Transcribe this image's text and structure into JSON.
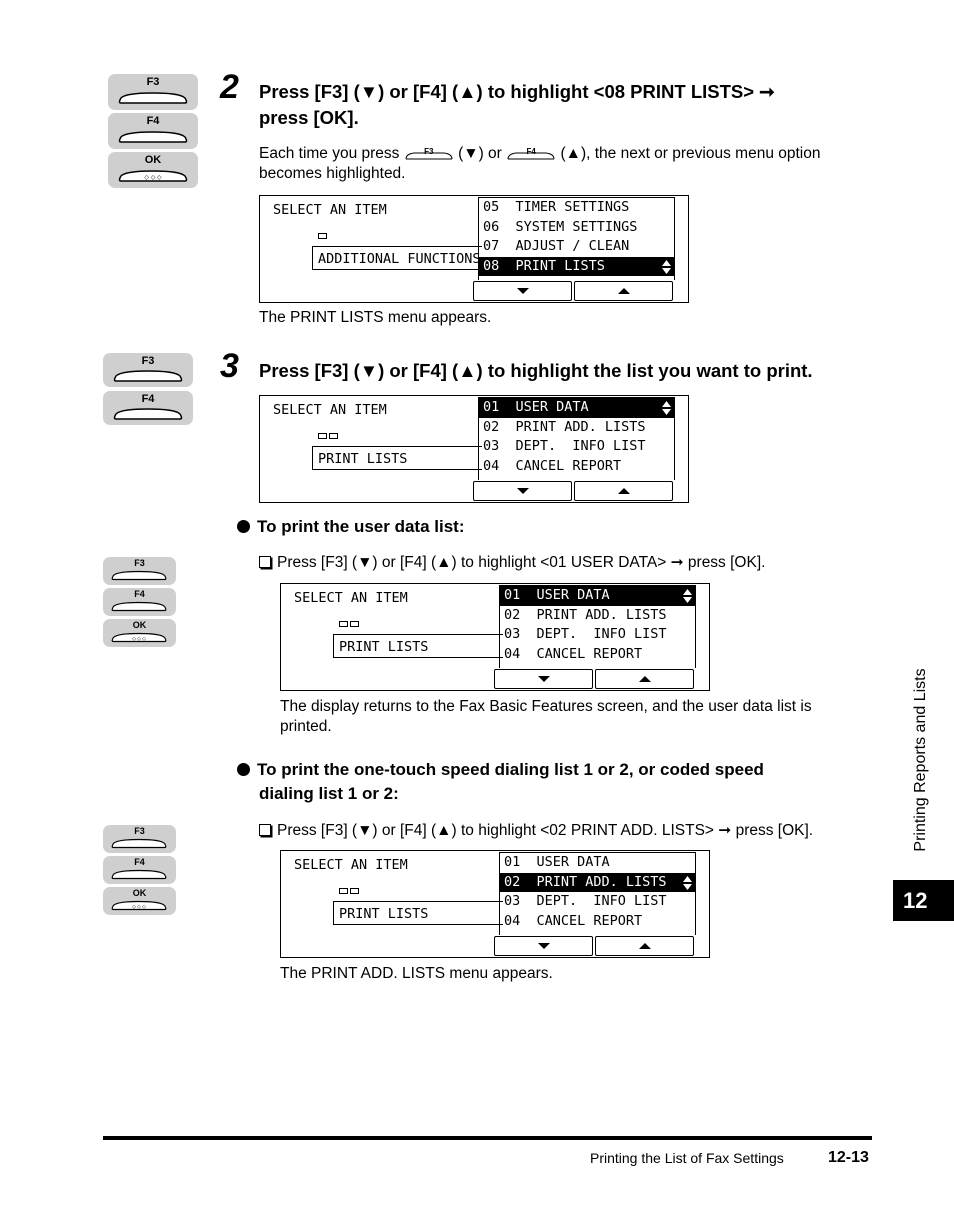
{
  "steps": [
    {
      "number": "2",
      "heading_line1": "Press [F3] (▼) or [F4] (▲) to highlight <08 PRINT LISTS> ➞",
      "heading_line2": "press [OK].",
      "keys": [
        "F3",
        "F4",
        "OK"
      ],
      "body_part1": "Each time you press",
      "body_key1": "F3",
      "body_part2": "(▼) or",
      "body_key2": "F4",
      "body_part3": "(▲), the next or previous menu option",
      "body_line2": "becomes highlighted.",
      "screen": {
        "title": "SELECT AN ITEM",
        "current": "ADDITIONAL FUNCTIONS",
        "menu": [
          "05  TIMER SETTINGS",
          "06  SYSTEM SETTINGS",
          "07  ADJUST / CLEAN",
          "08  PRINT LISTS"
        ],
        "selected_index": 3
      },
      "result": "The PRINT LISTS menu appears."
    },
    {
      "number": "3",
      "heading": "Press [F3] (▼) or [F4] (▲) to highlight the list you want to print.",
      "keys": [
        "F3",
        "F4"
      ],
      "screen": {
        "title": "SELECT AN ITEM",
        "current": "PRINT LISTS",
        "menu": [
          "01  USER DATA",
          "02  PRINT ADD. LISTS",
          "03  DEPT.  INFO LIST",
          "04  CANCEL REPORT"
        ],
        "selected_index": 0
      }
    }
  ],
  "sections": [
    {
      "heading": "To print the user data list:",
      "keys": [
        "F3",
        "F4",
        "OK"
      ],
      "instruction": "Press [F3] (▼) or [F4] (▲) to highlight <01 USER DATA> ➞ press [OK].",
      "screen": {
        "title": "SELECT AN ITEM",
        "current": "PRINT LISTS",
        "menu": [
          "01  USER DATA",
          "02  PRINT ADD. LISTS",
          "03  DEPT.  INFO LIST",
          "04  CANCEL REPORT"
        ],
        "selected_index": 0
      },
      "result_line1": "The display returns to the Fax Basic Features screen, and the user data list is",
      "result_line2": "printed."
    },
    {
      "heading_line1": "To print the one-touch speed dialing list 1 or 2, or coded speed",
      "heading_line2": "dialing list 1 or 2:",
      "keys": [
        "F3",
        "F4",
        "OK"
      ],
      "instruction": "Press [F3] (▼) or [F4] (▲) to highlight <02 PRINT ADD. LISTS> ➞ press [OK].",
      "screen": {
        "title": "SELECT AN ITEM",
        "current": "PRINT LISTS",
        "menu": [
          "01  USER DATA",
          "02  PRINT ADD. LISTS",
          "03  DEPT.  INFO LIST",
          "04  CANCEL REPORT"
        ],
        "selected_index": 1
      },
      "result": "The PRINT ADD. LISTS menu appears."
    }
  ],
  "sidebar": {
    "chapter_title": "Printing Reports and Lists",
    "chapter_number": "12"
  },
  "footer": {
    "section_title": "Printing the List of Fax Settings",
    "page_number": "12-13"
  }
}
